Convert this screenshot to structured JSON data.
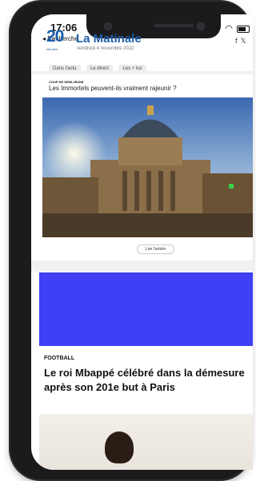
{
  "status_bar": {
    "time": "17:06",
    "back_label": "◂ Recherche"
  },
  "header": {
    "logo_number": "20",
    "logo_word": "minutes",
    "title": "La Matinale",
    "date": "vendredi 4 novembre 2022",
    "social_icons": [
      "facebook-icon",
      "twitter-icon"
    ],
    "tabs": [
      "Dans l'actu",
      "Le direct",
      "Les + lus"
    ]
  },
  "article1": {
    "kicker": "COUP DE SEMI-JEUNE",
    "headline": "Les Immortels peuvent-ils vraiment rajeunir ?",
    "button_label": "Lire l'article"
  },
  "article2": {
    "kicker": "FOOTBALL",
    "headline": "Le roi Mbappé célébré dans la démesure après son 201e but à Paris"
  },
  "colors": {
    "brand_blue": "#1d5fa8",
    "ad_blue": "#3f3ff5"
  }
}
